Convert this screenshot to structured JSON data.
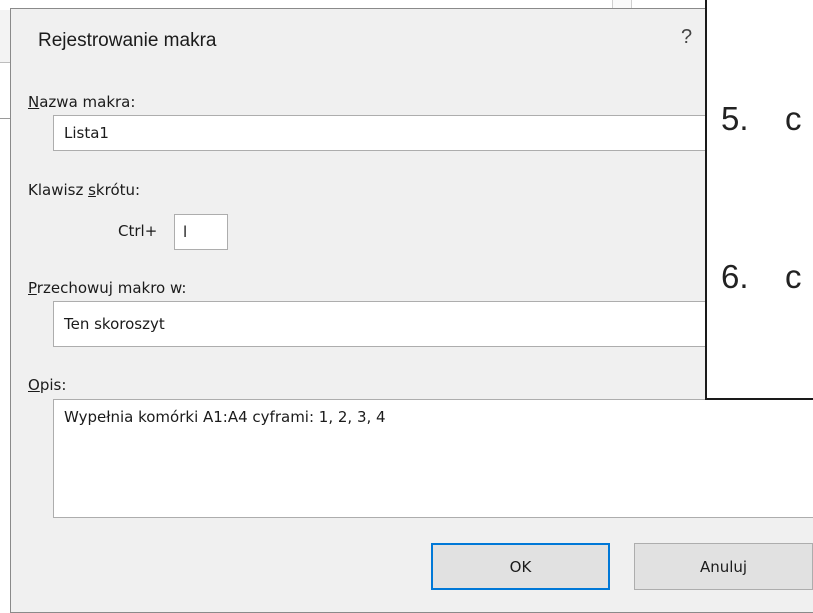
{
  "dialog": {
    "title": "Rejestrowanie makra",
    "help": "?",
    "macro_name": {
      "label_first": "N",
      "label_rest": "azwa makra:",
      "value": "Lista1"
    },
    "shortcut": {
      "label_pre": "Klawisz ",
      "label_ul": "s",
      "label_post": "krótu:",
      "prefix": "Ctrl+",
      "value": "l"
    },
    "store": {
      "label_first": "P",
      "label_rest": "rzechowuj makro w:",
      "value": "Ten skoroszyt"
    },
    "description": {
      "label_first": "O",
      "label_rest": "pis:",
      "value": "Wypełnia komórki A1:A4 cyframi: 1, 2, 3, 4"
    },
    "buttons": {
      "ok": "OK",
      "cancel": "Anuluj"
    }
  },
  "slide": {
    "items": [
      {
        "num": "5.",
        "text": "c"
      },
      {
        "num": "6.",
        "text": "c"
      }
    ]
  }
}
